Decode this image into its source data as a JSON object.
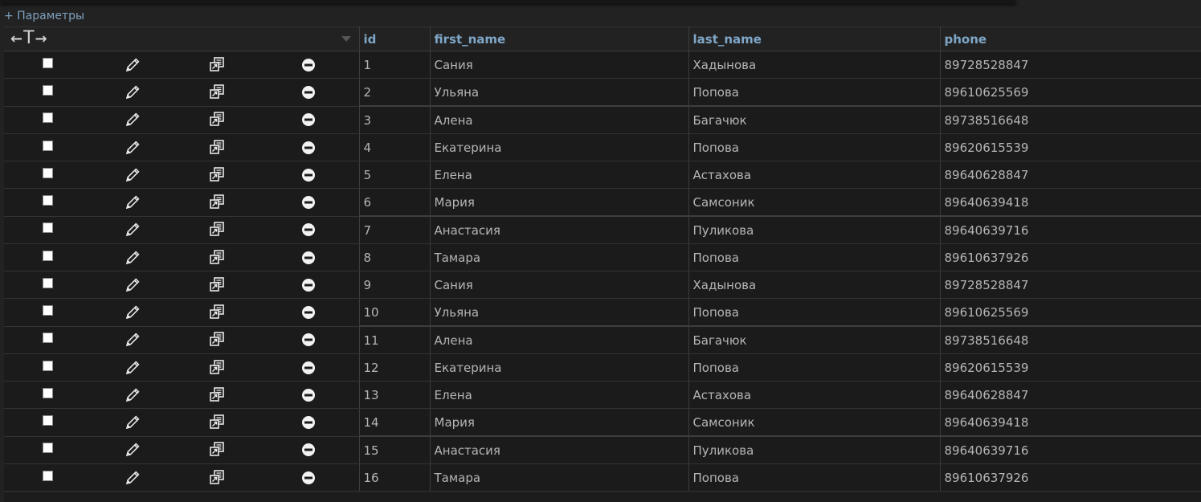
{
  "options_link": "+ Параметры",
  "columns": {
    "id": "id",
    "first_name": "first_name",
    "last_name": "last_name",
    "phone": "phone"
  },
  "rows": [
    {
      "id": "1",
      "first_name": "Сания",
      "last_name": "Хадынова",
      "phone": "89728528847"
    },
    {
      "id": "2",
      "first_name": "Ульяна",
      "last_name": "Попова",
      "phone": "89610625569"
    },
    {
      "id": "3",
      "first_name": "Алена",
      "last_name": "Багачюк",
      "phone": "89738516648"
    },
    {
      "id": "4",
      "first_name": "Екатерина",
      "last_name": "Попова",
      "phone": "89620615539"
    },
    {
      "id": "5",
      "first_name": "Елена",
      "last_name": "Астахова",
      "phone": "89640628847"
    },
    {
      "id": "6",
      "first_name": "Мария",
      "last_name": "Самсоник",
      "phone": "89640639418"
    },
    {
      "id": "7",
      "first_name": "Анастасия",
      "last_name": "Пуликова",
      "phone": "89640639716"
    },
    {
      "id": "8",
      "first_name": "Тамара",
      "last_name": "Попова",
      "phone": "89610637926"
    },
    {
      "id": "9",
      "first_name": "Сания",
      "last_name": "Хадынова",
      "phone": "89728528847"
    },
    {
      "id": "10",
      "first_name": "Ульяна",
      "last_name": "Попова",
      "phone": "89610625569"
    },
    {
      "id": "11",
      "first_name": "Алена",
      "last_name": "Багачюк",
      "phone": "89738516648"
    },
    {
      "id": "12",
      "first_name": "Екатерина",
      "last_name": "Попова",
      "phone": "89620615539"
    },
    {
      "id": "13",
      "first_name": "Елена",
      "last_name": "Астахова",
      "phone": "89640628847"
    },
    {
      "id": "14",
      "first_name": "Мария",
      "last_name": "Самсоник",
      "phone": "89640639418"
    },
    {
      "id": "15",
      "first_name": "Анастасия",
      "last_name": "Пуликова",
      "phone": "89640639716"
    },
    {
      "id": "16",
      "first_name": "Тамара",
      "last_name": "Попова",
      "phone": "89610637926"
    }
  ],
  "row_action_icons": [
    "checkbox",
    "pencil-icon",
    "copy-icon",
    "delete-icon"
  ],
  "colors": {
    "background": "#222222",
    "link": "#7fa0bd",
    "header_text": "#7fa6c6",
    "cell_text": "#b5b5b5"
  }
}
